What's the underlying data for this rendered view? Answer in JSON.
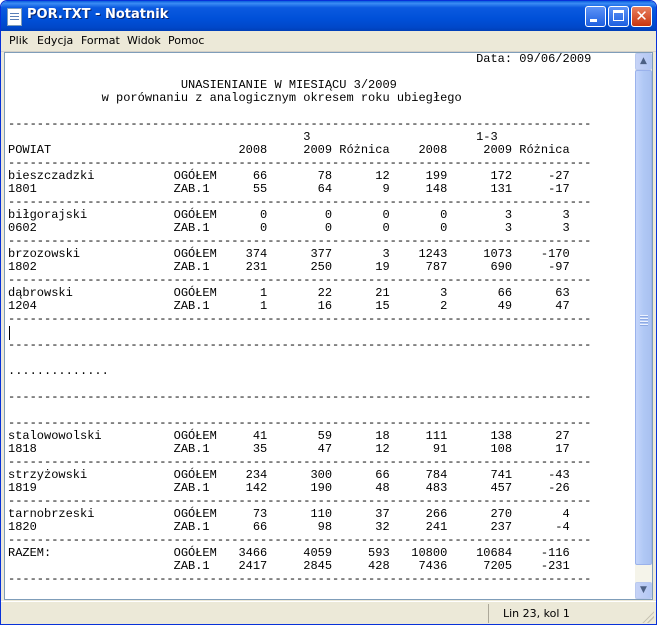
{
  "window": {
    "title": "POR.TXT - Notatnik"
  },
  "title_buttons": {
    "close_glyph": "✕"
  },
  "menu": [
    "Plik",
    "Edycja",
    "Format",
    "Widok",
    "Pomoc"
  ],
  "document": {
    "lines": [
      "                                                                 Data: 09/06/2009",
      "",
      "                        UNASIENIANIE W MIESIĄCU 3/2009",
      "             w porównaniu z analogicznym okresem roku ubiegłego",
      "",
      "---------------------------------------------------------------------------------",
      "                                         3                       1-3",
      "POWIAT                          2008     2009 Różnica    2008     2009 Różnica",
      "---------------------------------------------------------------------------------",
      "bieszczadzki           OGÓŁEM     66       78      12     199      172     -27",
      "1801                   ZAB.1      55       64       9     148      131     -17",
      "---------------------------------------------------------------------------------",
      "biłgorajski            OGÓŁEM      0        0       0       0        3       3",
      "0602                   ZAB.1       0        0       0       0        3       3",
      "---------------------------------------------------------------------------------",
      "brzozowski             OGÓŁEM    374      377       3    1243     1073    -170",
      "1802                   ZAB.1     231      250      19     787      690     -97",
      "---------------------------------------------------------------------------------",
      "dąbrowski              OGÓŁEM      1       22      21       3       66      63",
      "1204                   ZAB.1       1       16      15       2       49      47",
      "---------------------------------------------------------------------------------",
      "",
      "---------------------------------------------------------------------------------",
      "",
      "..............",
      "",
      "---------------------------------------------------------------------------------",
      "",
      "---------------------------------------------------------------------------------",
      "stalowowolski          OGÓŁEM     41       59      18     111      138      27",
      "1818                   ZAB.1      35       47      12      91      108      17",
      "---------------------------------------------------------------------------------",
      "strzyżowski            OGÓŁEM    234      300      66     784      741     -43",
      "1819                   ZAB.1     142      190      48     483      457     -26",
      "---------------------------------------------------------------------------------",
      "tarnobrzeski           OGÓŁEM     73      110      37     266      270       4",
      "1820                   ZAB.1      66       98      32     241      237      -4",
      "---------------------------------------------------------------------------------",
      "RAZEM:                 OGÓŁEM   3466     4059     593   10800    10684    -116",
      "                       ZAB.1    2417     2845     428    7436     7205    -231",
      "---------------------------------------------------------------------------------"
    ]
  },
  "scrollbar": {
    "up_glyph": "▲",
    "down_glyph": "▼"
  },
  "status": {
    "position": "Lin 23, kol 1"
  }
}
